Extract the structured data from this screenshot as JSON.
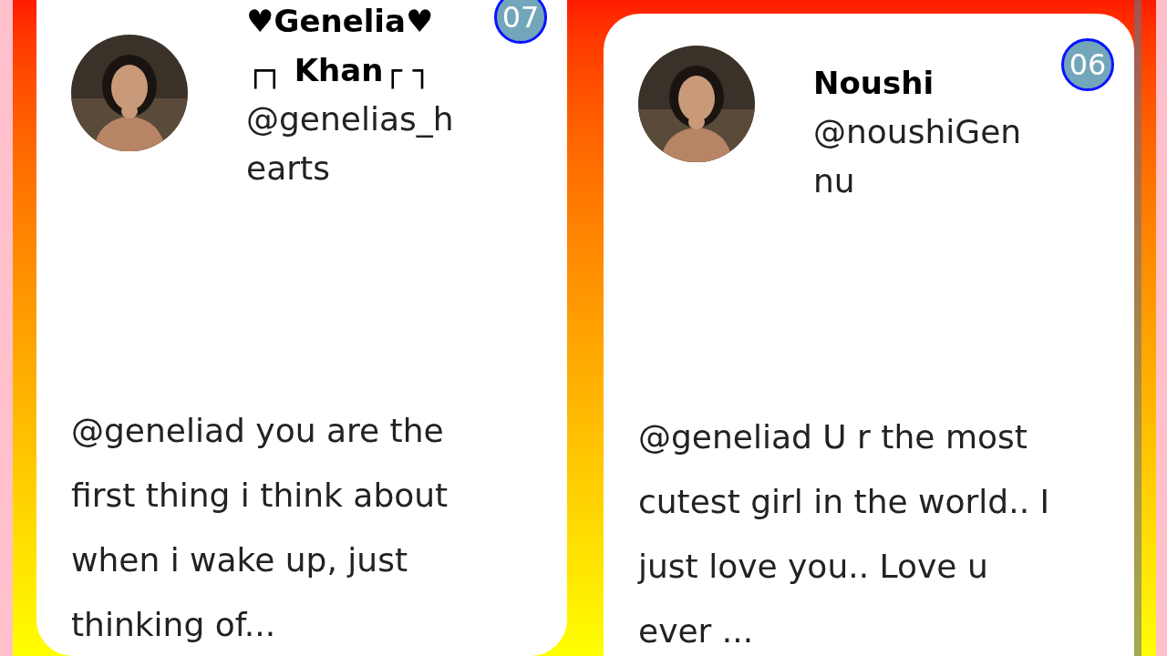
{
  "cards": [
    {
      "name": "♥Genelia♥ ┌┐ Khan┌ ┐",
      "handle": "@genelias_hearts",
      "count": "07",
      "text": "@geneliad you are the first thing i think about when i wake up, just thinking of..."
    },
    {
      "name": "Noushi",
      "handle": "@noushiGennu",
      "count": "06",
      "text": "@geneliad U r the most cutest girl in the world.. I just love you.. Love u ever ..."
    }
  ]
}
